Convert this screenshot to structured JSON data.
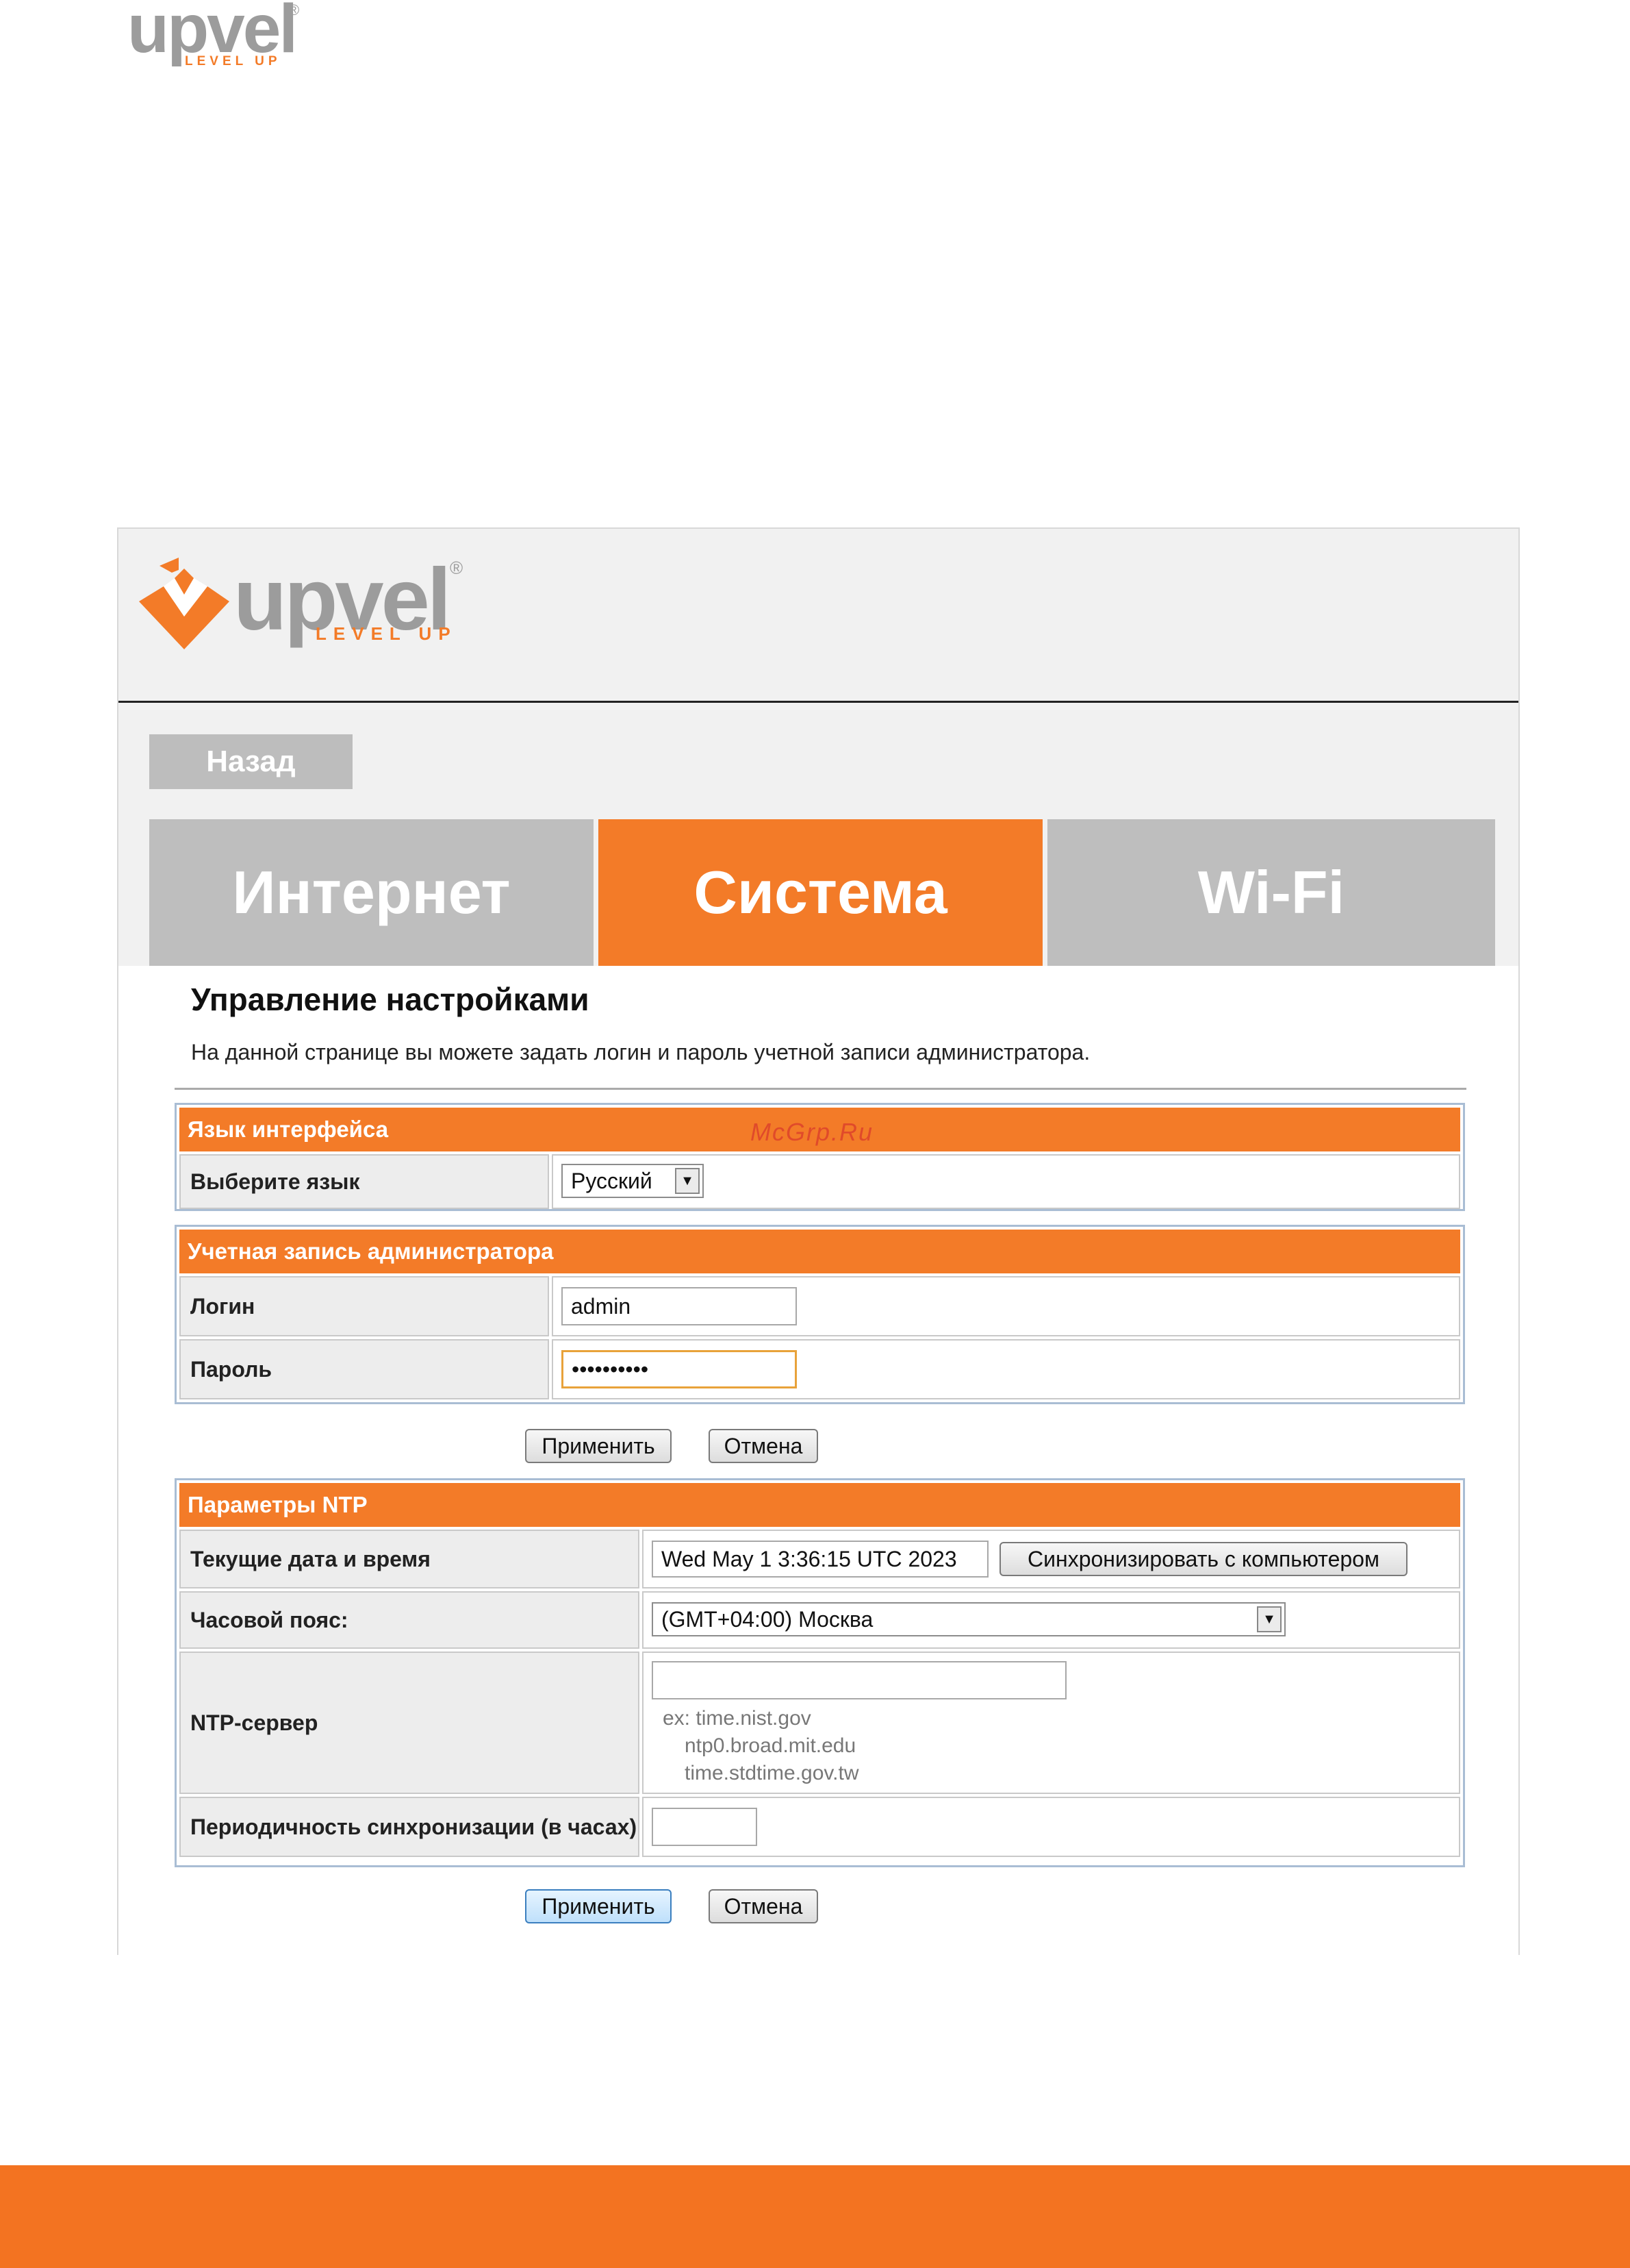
{
  "doc_logo": {
    "word": "upvel",
    "reg": "®",
    "tagline": "LEVEL UP"
  },
  "app_logo": {
    "word": "upvel",
    "reg": "®",
    "tagline": "LEVEL UP"
  },
  "nav": {
    "back_label": "Назад"
  },
  "tabs": [
    {
      "label": "Интернет",
      "active": false
    },
    {
      "label": "Система",
      "active": true
    },
    {
      "label": "Wi-Fi",
      "active": false
    }
  ],
  "page": {
    "title": "Управление настройками",
    "description": "На данной странице вы можете задать логин и пароль учетной записи администратора."
  },
  "watermark": "McGrp.Ru",
  "language_panel": {
    "header": "Язык интерфейса",
    "label": "Выберите язык",
    "selected": "Русский"
  },
  "admin_panel": {
    "header": "Учетная запись администратора",
    "login_label": "Логин",
    "login_value": "admin",
    "password_label": "Пароль",
    "password_value": "••••••••••"
  },
  "admin_buttons": {
    "apply": "Применить",
    "cancel": "Отмена"
  },
  "ntp_panel": {
    "header": "Параметры NTP",
    "datetime_label": "Текущие дата и время",
    "datetime_value": "Wed May 1 3:36:15 UTC 2023",
    "sync_button": "Синхронизировать с компьютером",
    "timezone_label": "Часовой пояс:",
    "timezone_value": "(GMT+04:00) Москва",
    "server_label": "NTP-сервер",
    "server_value": "",
    "server_hint_1": "ex: time.nist.gov",
    "server_hint_2": "ntp0.broad.mit.edu",
    "server_hint_3": "time.stdtime.gov.tw",
    "interval_label": "Периодичность синхронизации (в часах)",
    "interval_value": ""
  },
  "ntp_buttons": {
    "apply": "Применить",
    "cancel": "Отмена"
  },
  "colors": {
    "accent": "#f37b28",
    "footer": "#f37321",
    "tab_inactive": "#bebebe",
    "panel_border": "#a9bdd4"
  }
}
